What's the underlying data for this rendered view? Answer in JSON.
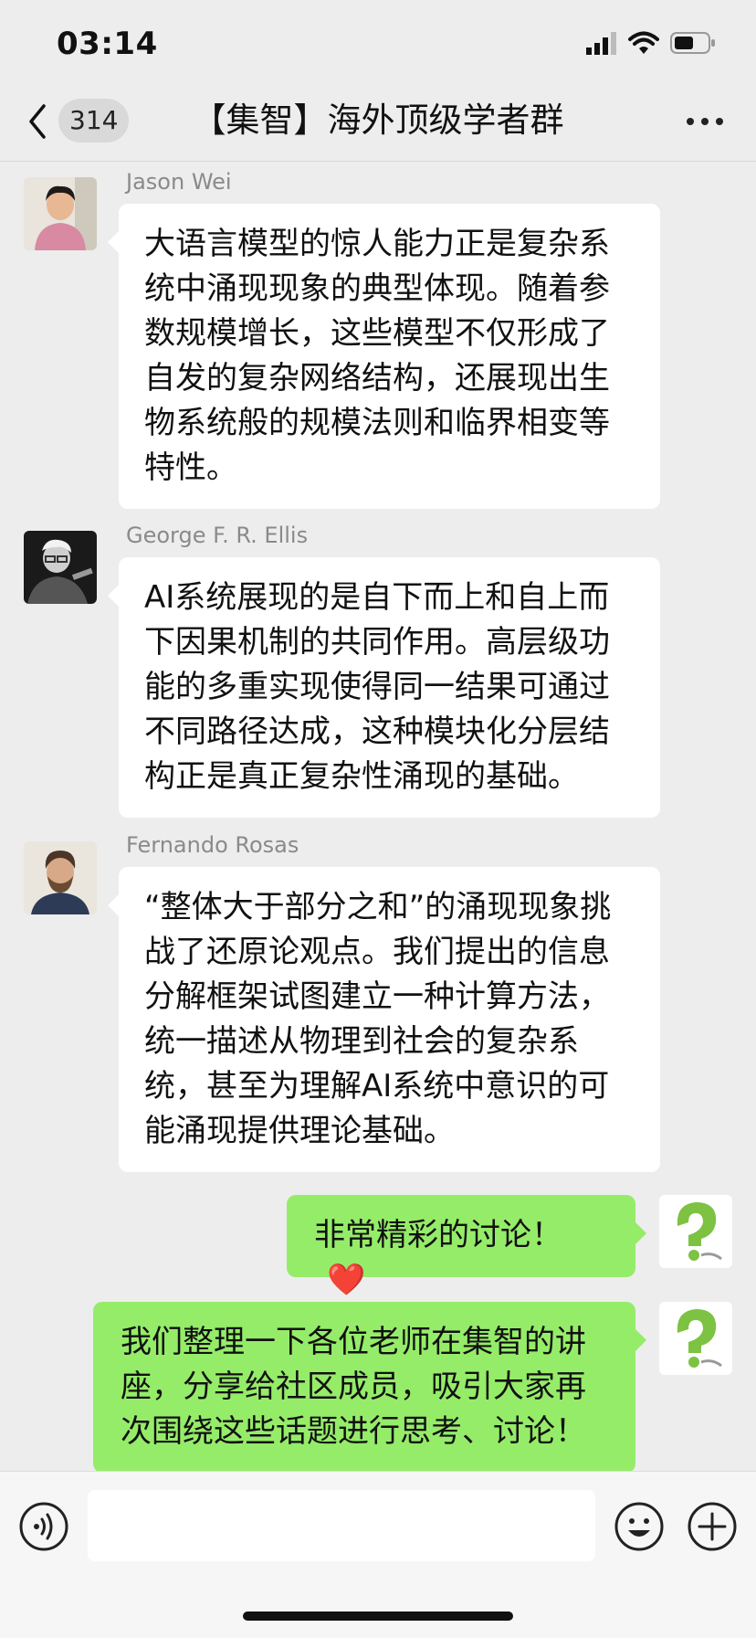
{
  "status_bar": {
    "time": "03:14"
  },
  "header": {
    "unread_count": "314",
    "title": "【集智】海外顶级学者群"
  },
  "messages": [
    {
      "sender": "Jason Wei",
      "text": "大语言模型的惊人能力正是复杂系统中涌现现象的典型体现。随着参数规模增长，这些模型不仅形成了自发的复杂网络结构，还展现出生物系统般的规模法则和临界相变等特性。"
    },
    {
      "sender": "George F. R. Ellis",
      "text": "AI系统展现的是自下而上和自上而下因果机制的共同作用。高层级功能的多重实现使得同一结果可通过不同路径达成，这种模块化分层结构正是真正复杂性涌现的基础。"
    },
    {
      "sender": "Fernando Rosas",
      "text": "“整体大于部分之和”的涌现现象挑战了还原论观点。我们提出的信息分解框架试图建立一种计算方法，统一描述从物理到社会的复杂系统，甚至为理解AI系统中意识的可能涌现提供理论基础。"
    },
    {
      "text": "非常精彩的讨论！",
      "emoji": "❤️"
    },
    {
      "text": "我们整理一下各位老师在集智的讲座，分享给社区成员，吸引大家再次围绕这些话题进行思考、讨论！"
    }
  ],
  "colors": {
    "incoming_bubble": "#ffffff",
    "outgoing_bubble": "#95ec69",
    "background": "#ededed"
  },
  "icons": [
    "signal-icon",
    "wifi-icon",
    "battery-icon",
    "back-chevron-icon",
    "more-icon",
    "voice-icon",
    "emoji-icon",
    "plus-icon"
  ]
}
